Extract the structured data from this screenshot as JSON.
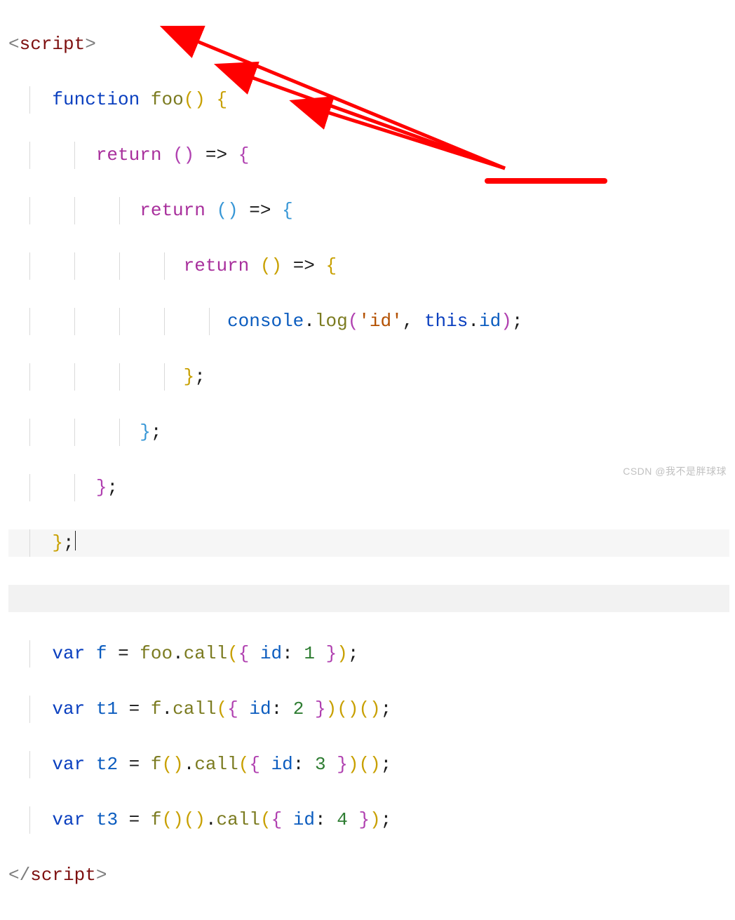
{
  "code": {
    "l1_open_angle": "<",
    "l1_tag": "script",
    "l1_close_angle": ">",
    "l2_function": "function",
    "l2_foo": "foo",
    "l2_paren_open": "(",
    "l2_paren_close": ")",
    "l2_brace": "{",
    "l3_return": "return",
    "l3_paren_open": "(",
    "l3_paren_close": ")",
    "l3_arrow": "=>",
    "l3_brace": "{",
    "l4_return": "return",
    "l4_paren_open": "(",
    "l4_paren_close": ")",
    "l4_arrow": "=>",
    "l4_brace": "{",
    "l5_return": "return",
    "l5_paren_open": "(",
    "l5_paren_close": ")",
    "l5_arrow": "=>",
    "l5_brace": "{",
    "l6_console": "console",
    "l6_dot1": ".",
    "l6_log": "log",
    "l6_popen": "(",
    "l6_str": "'id'",
    "l6_comma": ",",
    "l6_this": "this",
    "l6_dot2": ".",
    "l6_id": "id",
    "l6_pclose": ")",
    "l6_semi": ";",
    "l7_close": "}",
    "l7_semi": ";",
    "l8_close": "}",
    "l8_semi": ";",
    "l9_close": "}",
    "l9_semi": ";",
    "l10_close": "}",
    "l10_semi": ";",
    "l12_var": "var",
    "l12_f": "f",
    "l12_eq": "=",
    "l12_foo": "foo",
    "l12_dot": ".",
    "l12_call": "call",
    "l12_popen": "(",
    "l12_bopen": "{",
    "l12_id": "id",
    "l12_colon": ":",
    "l12_num": "1",
    "l12_bclose": "}",
    "l12_pclose": ")",
    "l12_semi": ";",
    "l13_var": "var",
    "l13_t": "t1",
    "l13_eq": "=",
    "l13_f": "f",
    "l13_dot": ".",
    "l13_call": "call",
    "l13_popen": "(",
    "l13_bopen": "{",
    "l13_id": "id",
    "l13_colon": ":",
    "l13_num": "2",
    "l13_bclose": "}",
    "l13_pclose": ")",
    "l13_p2o": "(",
    "l13_p2c": ")",
    "l13_p3o": "(",
    "l13_p3c": ")",
    "l13_semi": ";",
    "l14_var": "var",
    "l14_t": "t2",
    "l14_eq": "=",
    "l14_f": "f",
    "l14_p1o": "(",
    "l14_p1c": ")",
    "l14_dot": ".",
    "l14_call": "call",
    "l14_popen": "(",
    "l14_bopen": "{",
    "l14_id": "id",
    "l14_colon": ":",
    "l14_num": "3",
    "l14_bclose": "}",
    "l14_pclose": ")",
    "l14_p2o": "(",
    "l14_p2c": ")",
    "l14_semi": ";",
    "l15_var": "var",
    "l15_t": "t3",
    "l15_eq": "=",
    "l15_f": "f",
    "l15_p1o": "(",
    "l15_p1c": ")",
    "l15_p2o": "(",
    "l15_p2c": ")",
    "l15_dot": ".",
    "l15_call": "call",
    "l15_popen": "(",
    "l15_bopen": "{",
    "l15_id": "id",
    "l15_colon": ":",
    "l15_num": "4",
    "l15_bclose": "}",
    "l15_pclose": ")",
    "l15_semi": ";",
    "l16_open_angle": "</",
    "l16_tag": "script",
    "l16_close_angle": ">"
  },
  "watermark": "CSDN @我不是胖球球"
}
